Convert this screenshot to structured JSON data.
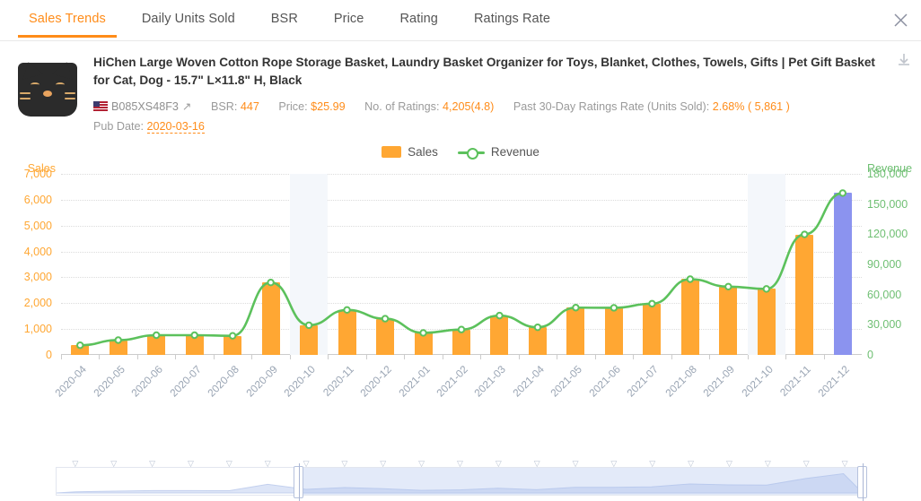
{
  "tabs": [
    {
      "label": "Sales Trends",
      "active": true
    },
    {
      "label": "Daily Units Sold",
      "active": false
    },
    {
      "label": "BSR",
      "active": false
    },
    {
      "label": "Price",
      "active": false
    },
    {
      "label": "Rating",
      "active": false
    },
    {
      "label": "Ratings Rate",
      "active": false
    }
  ],
  "close_icon": "close-icon",
  "product": {
    "title": "HiChen Large Woven Cotton Rope Storage Basket, Laundry Basket Organizer for Toys, Blanket, Clothes, Towels, Gifts | Pet Gift Basket for Cat, Dog - 15.7\" L×11.8\" H, Black",
    "asin": "B085XS48F3",
    "marketplace_flag": "us-flag-icon",
    "external_link_icon": "external-link-icon",
    "download_icon": "download-icon",
    "fields": [
      {
        "label": "BSR:",
        "value": "447"
      },
      {
        "label": "Price:",
        "value": "$25.99"
      },
      {
        "label": "No. of Ratings:",
        "value": "4,205(4.8)"
      },
      {
        "label": "Past 30-Day Ratings Rate (Units Sold):",
        "value": "2.68% ( 5,861 )"
      },
      {
        "label": "Pub Date:",
        "value": "2020-03-16"
      }
    ]
  },
  "legend": [
    {
      "label": "Sales",
      "color": "#ffa733",
      "type": "bar"
    },
    {
      "label": "Revenue",
      "color": "#5cc15c",
      "type": "line"
    }
  ],
  "chart_data": {
    "type": "bar",
    "title": "",
    "xlabel": "",
    "ylabel": "Sales",
    "y2label": "Revenue",
    "ylim": [
      0,
      7000
    ],
    "y2lim": [
      0,
      180000
    ],
    "yticks": [
      "0",
      "1,000",
      "2,000",
      "3,000",
      "4,000",
      "5,000",
      "6,000",
      "7,000"
    ],
    "y2ticks": [
      "0",
      "30,000",
      "60,000",
      "90,000",
      "120,000",
      "150,000",
      "180,000"
    ],
    "grid": true,
    "legend_position": "top-center",
    "highlight_bands": [
      "2020-10",
      "2021-10"
    ],
    "categories": [
      "2020-04",
      "2020-05",
      "2020-06",
      "2020-07",
      "2020-08",
      "2020-09",
      "2020-10",
      "2020-11",
      "2020-12",
      "2021-01",
      "2021-02",
      "2021-03",
      "2021-04",
      "2021-05",
      "2021-06",
      "2021-07",
      "2021-08",
      "2021-09",
      "2021-10",
      "2021-11",
      "2021-12"
    ],
    "series": [
      {
        "name": "Sales",
        "type": "bar",
        "color": "#ffa733",
        "forecast_color": "#8b93ef",
        "forecast_index": 20,
        "values": [
          370,
          570,
          760,
          760,
          740,
          2800,
          1150,
          1740,
          1400,
          850,
          980,
          1520,
          1070,
          1830,
          1820,
          1980,
          2930,
          2640,
          2550,
          4660,
          6260
        ]
      },
      {
        "name": "Revenue",
        "type": "line",
        "color": "#5cc15c",
        "values": [
          9600,
          14700,
          19600,
          19600,
          19000,
          72000,
          29500,
          44700,
          36000,
          21900,
          25200,
          39100,
          27500,
          47000,
          46800,
          50900,
          75300,
          67900,
          65600,
          119800,
          160900
        ]
      }
    ]
  },
  "datazoom": {
    "start_percent": 30,
    "end_percent": 100
  }
}
